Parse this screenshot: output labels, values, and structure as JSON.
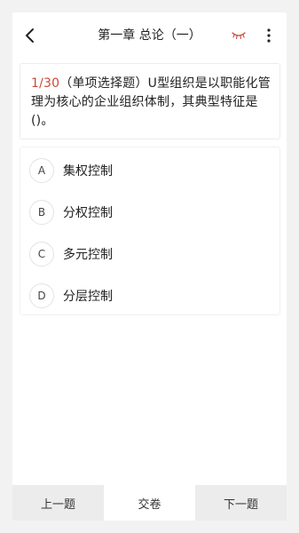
{
  "header": {
    "title": "第一章 总论（一）",
    "back_icon": "chevron-left-icon",
    "eye_icon": "closed-eye-icon",
    "more_icon": "vertical-dots-icon",
    "accent_color": "#c94a3a"
  },
  "question": {
    "number": "1/30",
    "text": "（单项选择题）U型组织是以职能化管理为核心的企业组织体制，其典型特征是()。"
  },
  "options": [
    {
      "letter": "A",
      "text": "集权控制"
    },
    {
      "letter": "B",
      "text": "分权控制"
    },
    {
      "letter": "C",
      "text": "多元控制"
    },
    {
      "letter": "D",
      "text": "分层控制"
    }
  ],
  "footer": {
    "prev_label": "上一题",
    "submit_label": "交卷",
    "next_label": "下一题"
  }
}
